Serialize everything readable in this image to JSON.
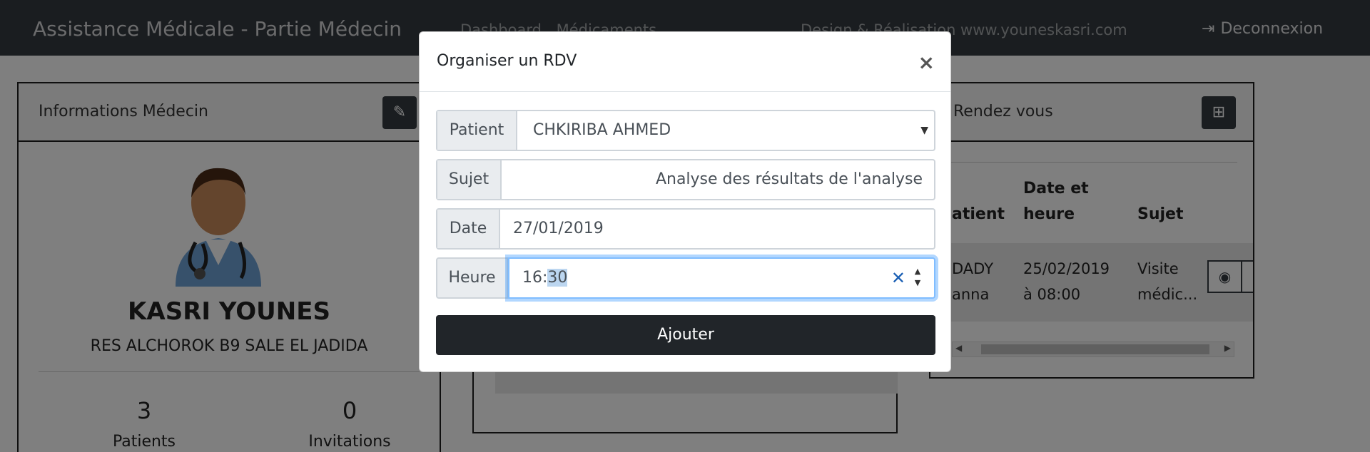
{
  "navbar": {
    "brand": "Assistance Médicale - Partie Médecin",
    "links": [
      "Dashboard",
      "Médicaments"
    ],
    "credit": "Design & Réalisation www.youneskasri.com",
    "logout_label": "Deconnexion"
  },
  "doctor_card": {
    "title": "Informations Médecin",
    "name": "KASRI YOUNES",
    "address": "RES ALCHOROK B9 SALE EL JADIDA",
    "stats": [
      {
        "value": "3",
        "label": "Patients"
      },
      {
        "value": "0",
        "label": "Invitations"
      }
    ]
  },
  "rdv_card": {
    "title": "Rendez vous",
    "columns": [
      "atient",
      "Date et heure",
      "Sujet"
    ],
    "rows": [
      {
        "patient": "DADY anna",
        "datetime": "25/02/2019 à 08:00",
        "subject": "Visite médic..."
      }
    ]
  },
  "modal": {
    "title": "Organiser un RDV",
    "close": "×",
    "fields": {
      "patient": {
        "label": "Patient",
        "value": "CHKIRIBA AHMED"
      },
      "subject": {
        "label": "Sujet",
        "value": "Analyse des résultats de l'analyse"
      },
      "date": {
        "label": "Date",
        "value": "27/01/2019"
      },
      "time": {
        "label": "Heure",
        "hours": "16:",
        "minutes": "30"
      }
    },
    "submit_label": "Ajouter"
  },
  "colors": {
    "navbar": "#343a40",
    "button_dark": "#212529",
    "danger": "#dc3545",
    "focus": "#80bdff"
  }
}
